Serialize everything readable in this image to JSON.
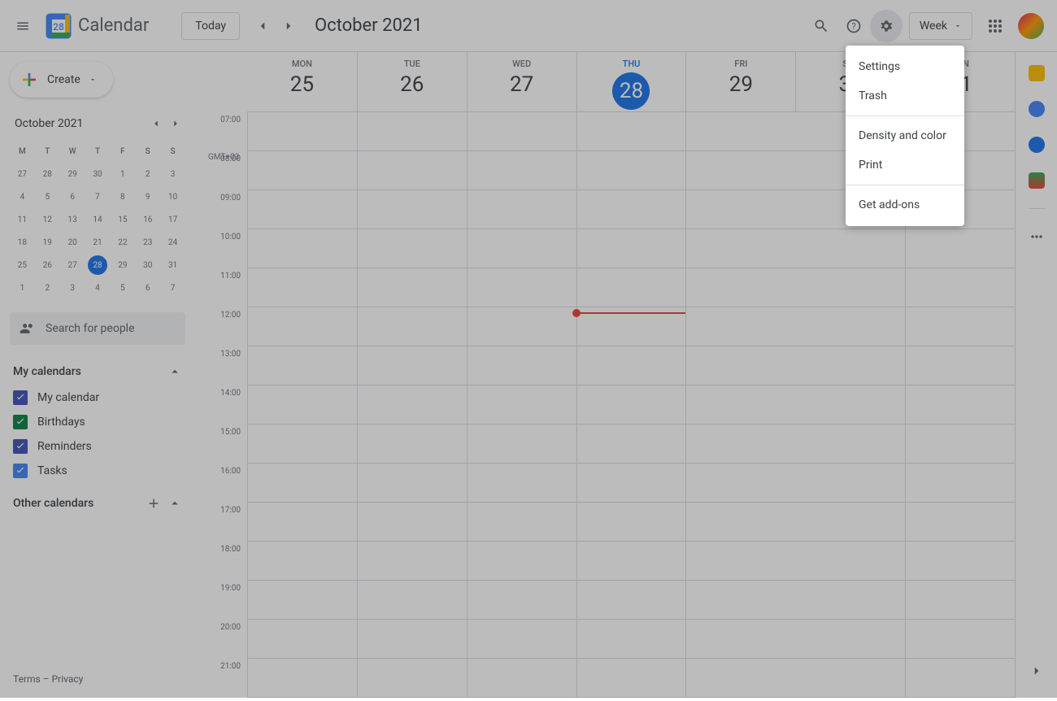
{
  "header": {
    "app_name": "Calendar",
    "today_btn": "Today",
    "month_title": "October 2021",
    "view_btn": "Week"
  },
  "sidebar": {
    "create": "Create",
    "mini_title": "October 2021",
    "dow": [
      "M",
      "T",
      "W",
      "T",
      "F",
      "S",
      "S"
    ],
    "weeks": [
      [
        "27",
        "28",
        "29",
        "30",
        "1",
        "2",
        "3"
      ],
      [
        "4",
        "5",
        "6",
        "7",
        "8",
        "9",
        "10"
      ],
      [
        "11",
        "12",
        "13",
        "14",
        "15",
        "16",
        "17"
      ],
      [
        "18",
        "19",
        "20",
        "21",
        "22",
        "23",
        "24"
      ],
      [
        "25",
        "26",
        "27",
        "28",
        "29",
        "30",
        "31"
      ],
      [
        "1",
        "2",
        "3",
        "4",
        "5",
        "6",
        "7"
      ]
    ],
    "today_cell": "28",
    "today_row": 4,
    "search_placeholder": "Search for people",
    "my_calendars": "My calendars",
    "other_calendars": "Other calendars",
    "calendars": [
      {
        "label": "My calendar",
        "color": "#3f51b5"
      },
      {
        "label": "Birthdays",
        "color": "#0b8043"
      },
      {
        "label": "Reminders",
        "color": "#3f51b5"
      },
      {
        "label": "Tasks",
        "color": "#4285f4"
      }
    ],
    "footer": "Terms – Privacy"
  },
  "grid": {
    "timezone": "GMT+03",
    "days": [
      {
        "dow": "Mon",
        "num": "25"
      },
      {
        "dow": "Tue",
        "num": "26"
      },
      {
        "dow": "Wed",
        "num": "27"
      },
      {
        "dow": "Thu",
        "num": "28",
        "today": true
      },
      {
        "dow": "Fri",
        "num": "29"
      },
      {
        "dow": "Sat",
        "num": "30"
      },
      {
        "dow": "Sun",
        "num": "31"
      }
    ],
    "hours": [
      "07:00",
      "08:00",
      "09:00",
      "10:00",
      "11:00",
      "12:00",
      "13:00",
      "14:00",
      "15:00",
      "16:00",
      "17:00",
      "18:00",
      "19:00",
      "20:00",
      "21:00"
    ]
  },
  "menu": {
    "settings": "Settings",
    "trash": "Trash",
    "density": "Density and color",
    "print": "Print",
    "addons": "Get add-ons"
  }
}
